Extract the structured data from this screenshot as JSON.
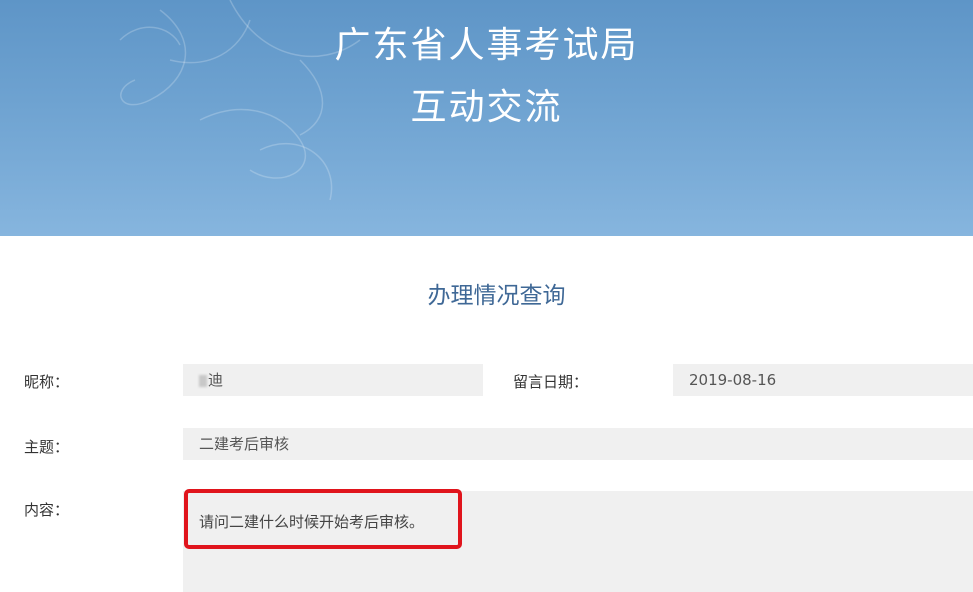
{
  "header": {
    "title_line1": "广东省人事考试局",
    "title_line2": "互动交流"
  },
  "page": {
    "heading": "办理情况查询"
  },
  "form": {
    "nickname_label": "昵称：",
    "nickname_value": "迪",
    "date_label": "留言日期：",
    "date_value": "2019-08-16",
    "subject_label": "主题：",
    "subject_value": "二建考后审核",
    "content_label": "内容：",
    "content_value": "请问二建什么时候开始考后审核。"
  },
  "colors": {
    "banner": "#6fa3d1",
    "heading": "#3f6896",
    "field_bg": "#f0f0f0",
    "highlight": "#e0141c"
  }
}
